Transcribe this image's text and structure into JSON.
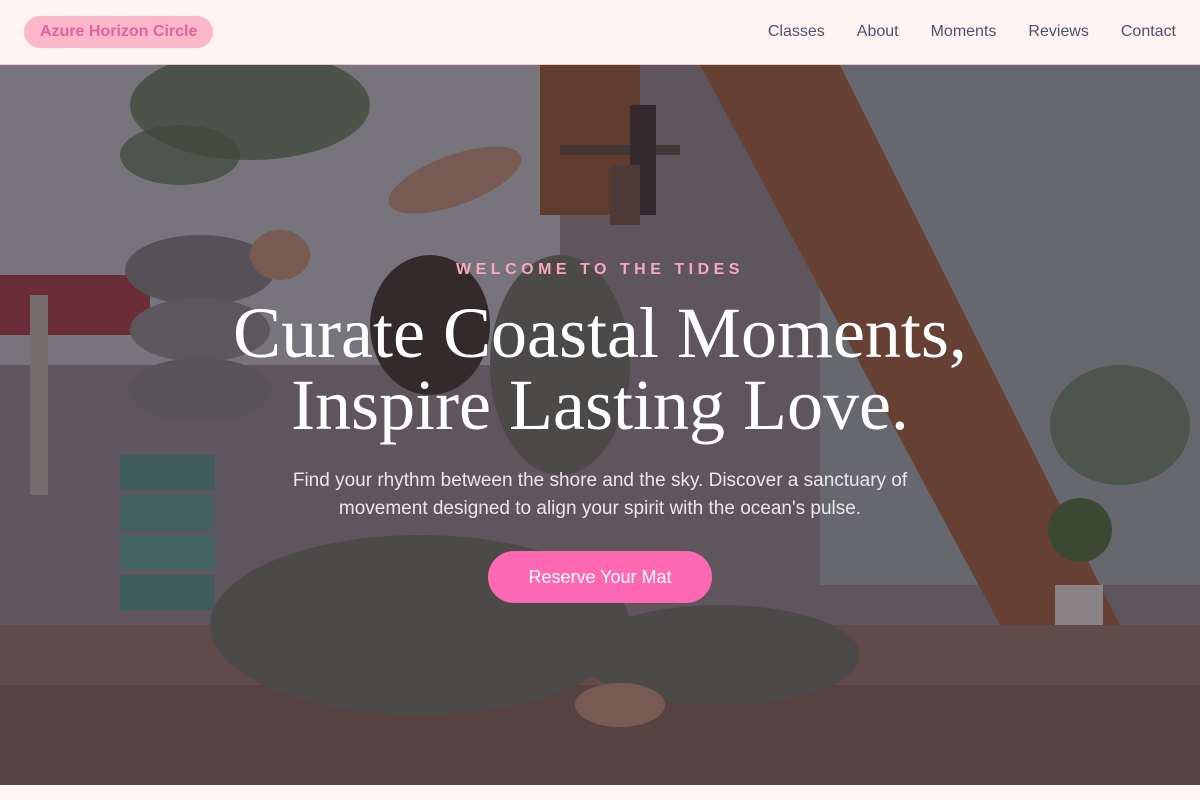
{
  "header": {
    "brand": "Azure Horizon Circle",
    "nav": [
      "Classes",
      "About",
      "Moments",
      "Reviews",
      "Contact"
    ]
  },
  "hero": {
    "eyebrow": "WELCOME TO THE TIDES",
    "headline_line1": "Curate Coastal Moments,",
    "headline_line2": "Inspire Lasting Love.",
    "subtext": "Find your rhythm between the shore and the sky. Discover a sanctuary of movement designed to align your spirit with the ocean's pulse.",
    "cta": "Reserve Your Mat",
    "background_image": "yoga-pose-photo"
  },
  "colors": {
    "brand_pill_bg": "#fbb8c9",
    "brand_text": "#e95ea2",
    "accent": "#ff69b4",
    "eyebrow": "#f7a8bf",
    "header_bg": "#fff3f4"
  }
}
